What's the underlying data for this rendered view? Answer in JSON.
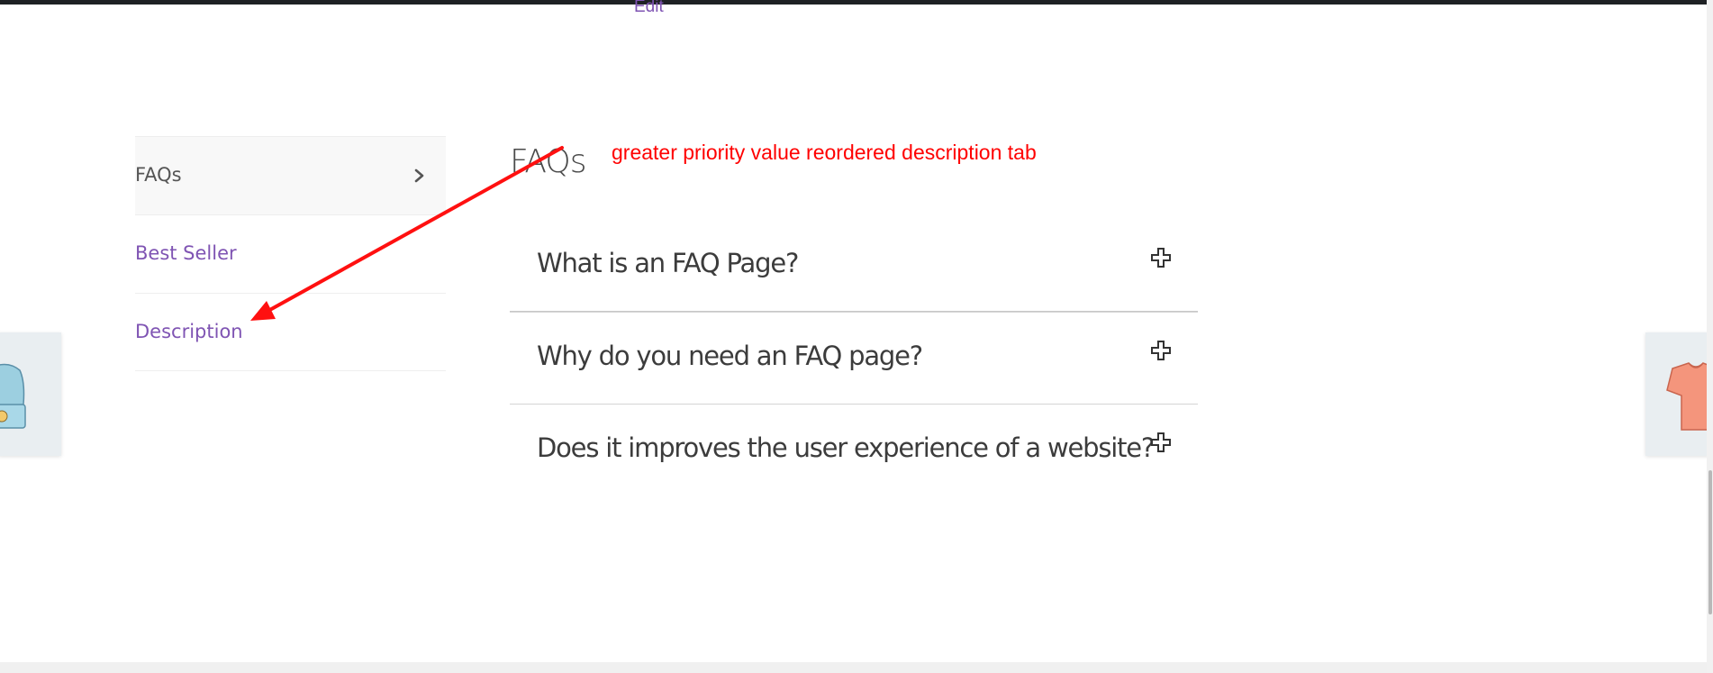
{
  "header": {
    "edit_label": "Edit"
  },
  "tabs": [
    {
      "label": "FAQs",
      "active": true
    },
    {
      "label": "Best Seller",
      "active": false
    },
    {
      "label": "Description",
      "active": false
    }
  ],
  "content": {
    "title": "FAQs",
    "faqs": [
      {
        "question": "What is an FAQ Page?"
      },
      {
        "question": "Why do you need an FAQ page?"
      },
      {
        "question": "Does it improves the user experience of a website?"
      }
    ]
  },
  "annotation": {
    "text": "greater priority value reordered description tab",
    "color": "#ff0000"
  },
  "colors": {
    "link": "#7f54b3",
    "text": "#555555",
    "top_bar": "#1e2124"
  },
  "icons": {
    "tab_active": "chevron-right-icon",
    "faq_toggle": "plus-icon"
  }
}
